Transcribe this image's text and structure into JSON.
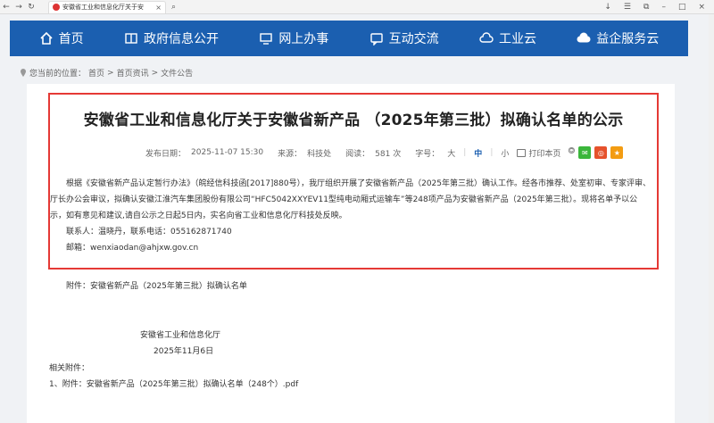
{
  "browser": {
    "tab_title": "安徽省工业和信息化厅关于安",
    "tab_close": "×",
    "back": "←",
    "forward": "→",
    "reload": "↻",
    "search_glyph": "⌕",
    "right_icons": [
      "↓",
      "☰",
      "⧉",
      "–",
      "□",
      "×"
    ]
  },
  "nav": {
    "items": [
      {
        "label": "首页",
        "icon": "home-icon"
      },
      {
        "label": "政府信息公开",
        "icon": "book-icon"
      },
      {
        "label": "网上办事",
        "icon": "monitor-icon"
      },
      {
        "label": "互动交流",
        "icon": "chat-icon"
      },
      {
        "label": "工业云",
        "icon": "cloud-icon"
      },
      {
        "label": "益企服务云",
        "icon": "cloud-icon"
      }
    ]
  },
  "breadcrumb": {
    "prefix": "您当前的位置：",
    "items": [
      "首页",
      "首页资讯",
      "文件公告"
    ],
    "sep": ">"
  },
  "article": {
    "title": "安徽省工业和信息化厅关于安徽省新产品 （2025年第三批）拟确认名单的公示",
    "meta": {
      "date_label": "发布日期：",
      "date": "2025-11-07 15:30",
      "source_label": "来源：",
      "source": "科技处",
      "views_label": "阅读：",
      "views": "581 次",
      "fontsize_label": "字号：",
      "sizes": [
        "大",
        "中",
        "小"
      ],
      "print": "打印本页"
    },
    "paragraph": "根据《安徽省新产品认定暂行办法》（皖经信科技函[2017]880号），我厅组织开展了安徽省新产品（2025年第三批）确认工作。经各市推荐、处室初审、专家评审、厅长办公会审议，拟确认安徽江淮汽车集团股份有限公司“HFC5042XXYEV11型纯电动厢式运输车”等248项产品为安徽省新产品（2025年第三批）。现将名单予以公示，如有意见和建议,请自公示之日起5日内，实名向省工业和信息化厅科技处反映。",
    "contact": "联系人：温晓丹，联系电话：055162871740",
    "email": "邮箱：wenxiaodan@ahjxw.gov.cn",
    "attachment": "附件：安徽省新产品（2025年第三批）拟确认名单",
    "org": "安徽省工业和信息化厅",
    "date_sign": "2025年11月6日",
    "related_label": "相关附件：",
    "related_item": "1、附件：安徽省新产品（2025年第三批）拟确认名单（248个）.pdf"
  },
  "colors": {
    "nav_bg": "#1b5fb0",
    "highlight": "#e53935",
    "wechat": "#3bb63b",
    "weibo": "#e6522c",
    "star": "#f39c12"
  }
}
